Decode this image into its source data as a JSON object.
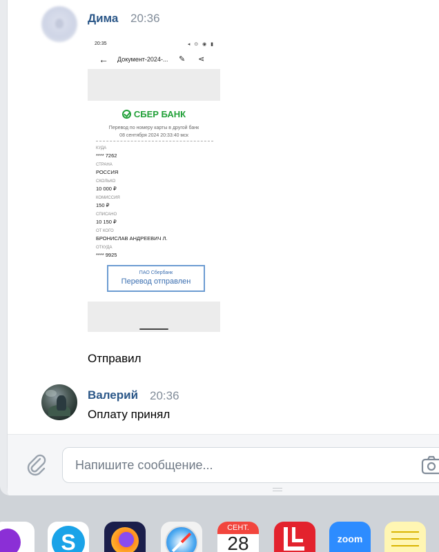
{
  "messages": [
    {
      "sender": "Дима",
      "time": "20:36",
      "attachment": {
        "status_time": "20:35",
        "title": "Документ-2024-...",
        "bank_name": "СБЕР БАНК",
        "transfer_type": "Перевод по номеру карты в другой банк",
        "datetime": "08 сентября 2024 20:33:40 мск",
        "fields": [
          {
            "label": "КУДА",
            "value": "**** 7262"
          },
          {
            "label": "СТРАНА",
            "value": "РОССИЯ"
          },
          {
            "label": "СКОЛЬКО",
            "value": "10 000 ₽"
          },
          {
            "label": "КОМИССИЯ",
            "value": "150 ₽"
          },
          {
            "label": "СПИСАНО",
            "value": "10 150 ₽"
          },
          {
            "label": "ОТ КОГО",
            "value": "БРОНИСЛАВ АНДРЕЕВИЧ Л."
          },
          {
            "label": "ОТКУДА",
            "value": "**** 9925"
          }
        ],
        "stamp_bank": "ПАО Сбербанк",
        "stamp_status": "Перевод отправлен"
      },
      "text": "Отправил"
    },
    {
      "sender": "Валерий",
      "time": "20:36",
      "text": "Оплату принял"
    }
  ],
  "composer": {
    "placeholder": "Напишите сообщение...",
    "attach_icon": "paperclip-icon",
    "camera_icon": "camera-icon"
  },
  "dock": {
    "calendar_month": "СЕНТ.",
    "calendar_day": "28",
    "zoom_label": "zoom",
    "skype_letter": "S",
    "apps": [
      "app-icon-purple",
      "skype-icon",
      "firefox-icon",
      "safari-icon",
      "calendar-icon",
      "app-icon-red",
      "zoom-icon",
      "notes-icon"
    ]
  },
  "colors": {
    "sender": "#2b5788",
    "time": "#818c99",
    "sber_green": "#21a038",
    "stamp_blue": "#3a6eb0"
  }
}
